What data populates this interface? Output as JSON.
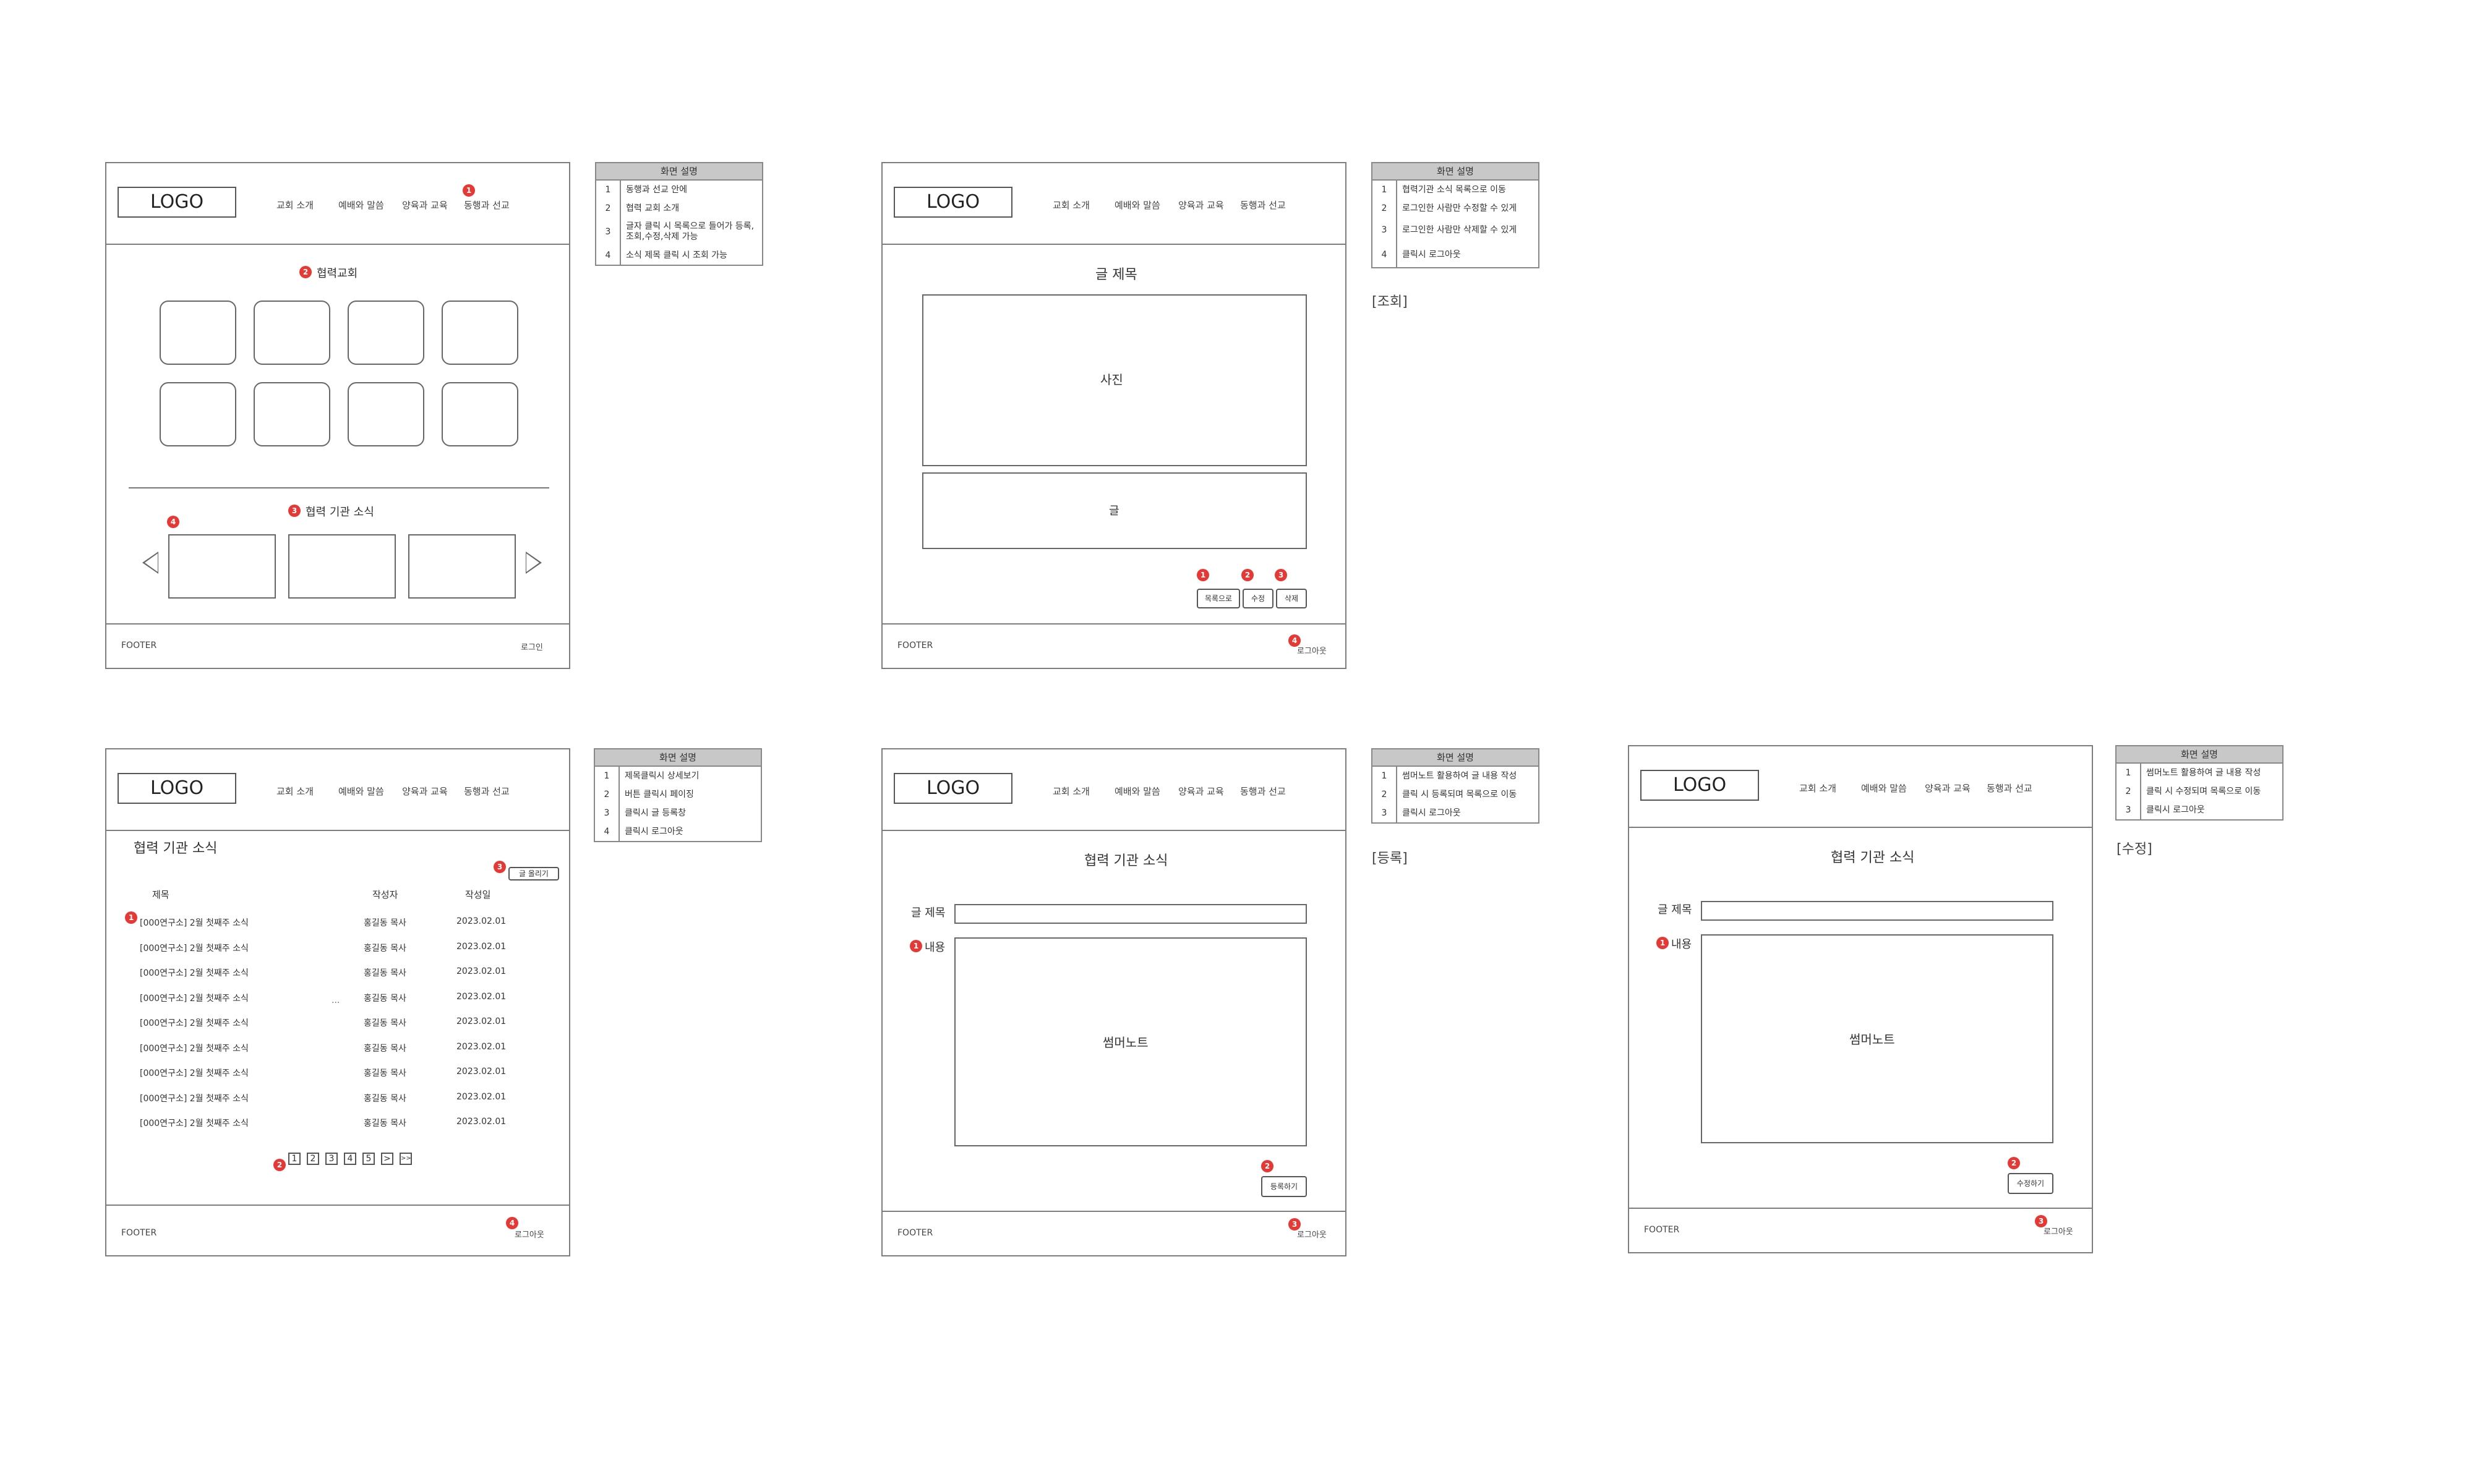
{
  "nav": [
    "교회 소개",
    "예배와 말씀",
    "양육과 교육",
    "동행과 선교"
  ],
  "logo": "LOGO",
  "footer": "FOOTER",
  "desc_header": "화면 설명",
  "screen1": {
    "section_church": "협력교회",
    "section_news": "협력 기관 소식",
    "footer_right": "로그인",
    "badges": [
      "1",
      "2",
      "3",
      "4"
    ],
    "desc": [
      {
        "n": "1",
        "t": "동행과 선교 안에"
      },
      {
        "n": "2",
        "t": "협력 교회 소개"
      },
      {
        "n": "3",
        "t": "글자 클릭 시 목록으로 들어가 등록,조회,수정,삭제 가능"
      },
      {
        "n": "4",
        "t": "소식 제목 클릭 시 조회 가능"
      }
    ]
  },
  "screen2": {
    "post_title": "글 제목",
    "photo": "사진",
    "text": "글",
    "btn_list": "목록으로",
    "btn_edit": "수정",
    "btn_delete": "삭제",
    "footer_right": "로그아웃",
    "note": "[조회]",
    "badges": [
      "1",
      "2",
      "3",
      "4"
    ],
    "desc": [
      {
        "n": "1",
        "t": "협력기관 소식 목록으로 이동"
      },
      {
        "n": "2",
        "t": "로그인한 사람만 수정할 수 있게"
      },
      {
        "n": "3",
        "t": "로그인한 사람만 삭제할 수 있게"
      },
      {
        "n": "4",
        "t": "클릭시 로그아웃"
      }
    ]
  },
  "screen3": {
    "title": "협력 기관 소식",
    "write_btn": "글 올리기",
    "col_title": "제목",
    "col_author": "작성자",
    "col_date": "작성일",
    "ellipsis": "...",
    "rows": [
      {
        "title": "[000연구소] 2월 첫째주 소식",
        "author": "홍길동 목사",
        "date": "2023.02.01"
      },
      {
        "title": "[000연구소] 2월 첫째주 소식",
        "author": "홍길동 목사",
        "date": "2023.02.01"
      },
      {
        "title": "[000연구소] 2월 첫째주 소식",
        "author": "홍길동 목사",
        "date": "2023.02.01"
      },
      {
        "title": "[000연구소] 2월 첫째주 소식",
        "author": "홍길동 목사",
        "date": "2023.02.01"
      },
      {
        "title": "[000연구소] 2월 첫째주 소식",
        "author": "홍길동 목사",
        "date": "2023.02.01"
      },
      {
        "title": "[000연구소] 2월 첫째주 소식",
        "author": "홍길동 목사",
        "date": "2023.02.01"
      },
      {
        "title": "[000연구소] 2월 첫째주 소식",
        "author": "홍길동 목사",
        "date": "2023.02.01"
      },
      {
        "title": "[000연구소] 2월 첫째주 소식",
        "author": "홍길동 목사",
        "date": "2023.02.01"
      },
      {
        "title": "[000연구소] 2월 첫째주 소식",
        "author": "홍길동 목사",
        "date": "2023.02.01"
      }
    ],
    "pages": [
      "1",
      "2",
      "3",
      "4",
      "5",
      ">",
      ">>"
    ],
    "footer_right": "로그아웃",
    "badges": [
      "1",
      "2",
      "3",
      "4"
    ],
    "desc": [
      {
        "n": "1",
        "t": "제목클릭시 상세보기"
      },
      {
        "n": "2",
        "t": "버튼 클릭시 페이징"
      },
      {
        "n": "3",
        "t": "클릭시 글 등록창"
      },
      {
        "n": "4",
        "t": "클릭시 로그아웃"
      }
    ]
  },
  "screen4": {
    "title": "협력 기관 소식",
    "label_title": "글 제목",
    "label_content": "내용",
    "editor": "썸머노트",
    "submit_btn": "등록하기",
    "footer_right": "로그아웃",
    "note": "[등록]",
    "badges": [
      "1",
      "2",
      "3"
    ],
    "desc": [
      {
        "n": "1",
        "t": "썸머노트 활용하여 글 내용 작성"
      },
      {
        "n": "2",
        "t": "클릭 시 등록되며 목록으로 이동"
      },
      {
        "n": "3",
        "t": "클릭시 로그아웃"
      }
    ]
  },
  "screen5": {
    "title": "협력 기관 소식",
    "label_title": "글 제목",
    "label_content": "내용",
    "editor": "썸머노트",
    "submit_btn": "수정하기",
    "footer_right": "로그아웃",
    "note": "[수정]",
    "badges": [
      "1",
      "2",
      "3"
    ],
    "desc": [
      {
        "n": "1",
        "t": "썸머노트 활용하여 글 내용 작성"
      },
      {
        "n": "2",
        "t": "클릭 시 수정되며 목록으로 이동"
      },
      {
        "n": "3",
        "t": "클릭시 로그아웃"
      }
    ]
  }
}
